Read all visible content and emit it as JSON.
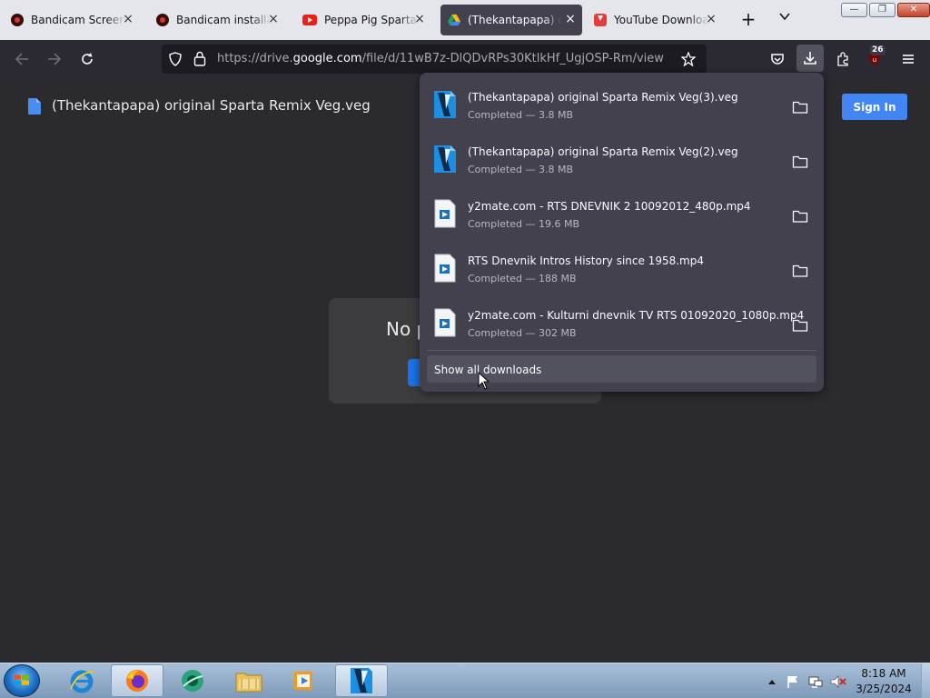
{
  "tabs": [
    {
      "title": "Bandicam Screen Recorder",
      "icon": "bandicam-record-icon",
      "active": false
    },
    {
      "title": "Bandicam installation",
      "icon": "bandicam-record-icon",
      "active": false
    },
    {
      "title": "Peppa Pig Sparta Dance",
      "icon": "youtube-icon",
      "active": false
    },
    {
      "title": "(Thekantapapa) original",
      "icon": "google-drive-icon",
      "active": true
    },
    {
      "title": "YouTube Downloader",
      "icon": "download-site-icon",
      "active": false
    }
  ],
  "window_controls": {
    "minimize": "—",
    "restore": "❐",
    "close": "✕"
  },
  "navbar": {
    "url_prefix": "https://drive.",
    "url_domain": "google.com",
    "url_suffix": "/file/d/11wB7z-DlQDvRPs30KtlkHf_UgjOSP-Rm/view",
    "extension_badge": "26"
  },
  "page": {
    "file_title": "(Thekantapapa) original Sparta Remix Veg.veg",
    "sign_in_label": "Sign In",
    "preview_message": "No p"
  },
  "downloads_panel": {
    "items": [
      {
        "name": "(Thekantapapa) original Sparta Remix Veg(3).veg",
        "status": "Completed — 3.8 MB",
        "icon": "vegas-file-icon"
      },
      {
        "name": "(Thekantapapa) original Sparta Remix Veg(2).veg",
        "status": "Completed — 3.8 MB",
        "icon": "vegas-file-icon"
      },
      {
        "name": "y2mate.com - RTS DNEVNIK 2 10092012_480p.mp4",
        "status": "Completed — 19.6 MB",
        "icon": "video-file-icon"
      },
      {
        "name": "RTS Dnevnik Intros History since 1958.mp4",
        "status": "Completed — 188 MB",
        "icon": "video-file-icon"
      },
      {
        "name": "y2mate.com - Kulturni dnevnik TV RTS 01092020_1080p.mp4",
        "status": "Completed — 302 MB",
        "icon": "video-file-icon"
      }
    ],
    "show_all_label": "Show all downloads"
  },
  "taskbar": {
    "apps": [
      "internet-explorer",
      "firefox",
      "dvd-player",
      "file-explorer",
      "media-player",
      "vegas-pro"
    ],
    "clock_time": "8:18 AM",
    "clock_date": "3/25/2024"
  }
}
